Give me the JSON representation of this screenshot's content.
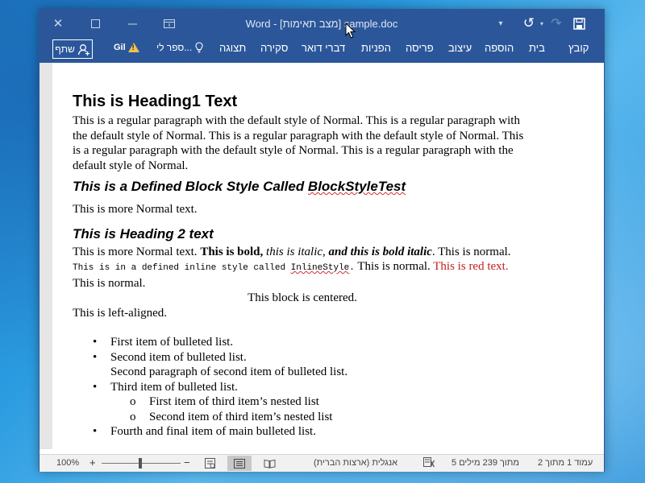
{
  "window": {
    "title": "Word - [מצב תאימות] sample.doc"
  },
  "ribbon": {
    "tabs": [
      "קובץ",
      "בית",
      "הוספה",
      "עיצוב",
      "פריסה",
      "הפניות",
      "דברי דואר",
      "סקירה",
      "תצוגה"
    ],
    "tell_me": "ספר לי...",
    "user": "Gil",
    "share": "שתף"
  },
  "document": {
    "heading1": "This is Heading1 Text",
    "para1": "This is a regular paragraph with the default style of Normal. This is a regular paragraph with the default style of Normal. This is a regular paragraph with the default style of Normal. This is a regular paragraph with the default style of Normal. This is a regular paragraph with the default style of Normal.",
    "block_style_prefix": "This is a Defined Block Style Called ",
    "block_style_name": "BlockStyleTest",
    "more_normal": "This is more Normal text.",
    "heading2": "This is Heading 2 text",
    "mixed": {
      "normal1": "This is more Normal text. ",
      "bold": "This is bold,",
      "space1": " ",
      "italic": "this is italic",
      "comma": ", ",
      "bold_italic": "and this is bold italic",
      "after_bi": ". This is normal. ",
      "inline_prefix": "This is in a defined inline style called ",
      "inline_name": "InlineStyle",
      "inline_suffix": ".",
      "after_inline": " This is normal. ",
      "red": "This is red text.",
      "end": " This is normal."
    },
    "centered": "This block is centered.",
    "left": "This is left-aligned.",
    "list": {
      "item1": "First item of bulleted list.",
      "item2": "Second item of bulleted list.",
      "item2_para": "Second paragraph of second item of bulleted list.",
      "item3": "Third item of bulleted list.",
      "item3_nested1": "First item of third item’s nested list",
      "item3_nested2": "Second item of third item’s nested list",
      "item4": "Fourth and final item of main bulleted list."
    }
  },
  "statusbar": {
    "page": "עמוד 1 מתוך 2",
    "words": "5 מתוך 239 מילים",
    "language": "אנגלית (ארצות הברית)",
    "zoom": "100%"
  }
}
